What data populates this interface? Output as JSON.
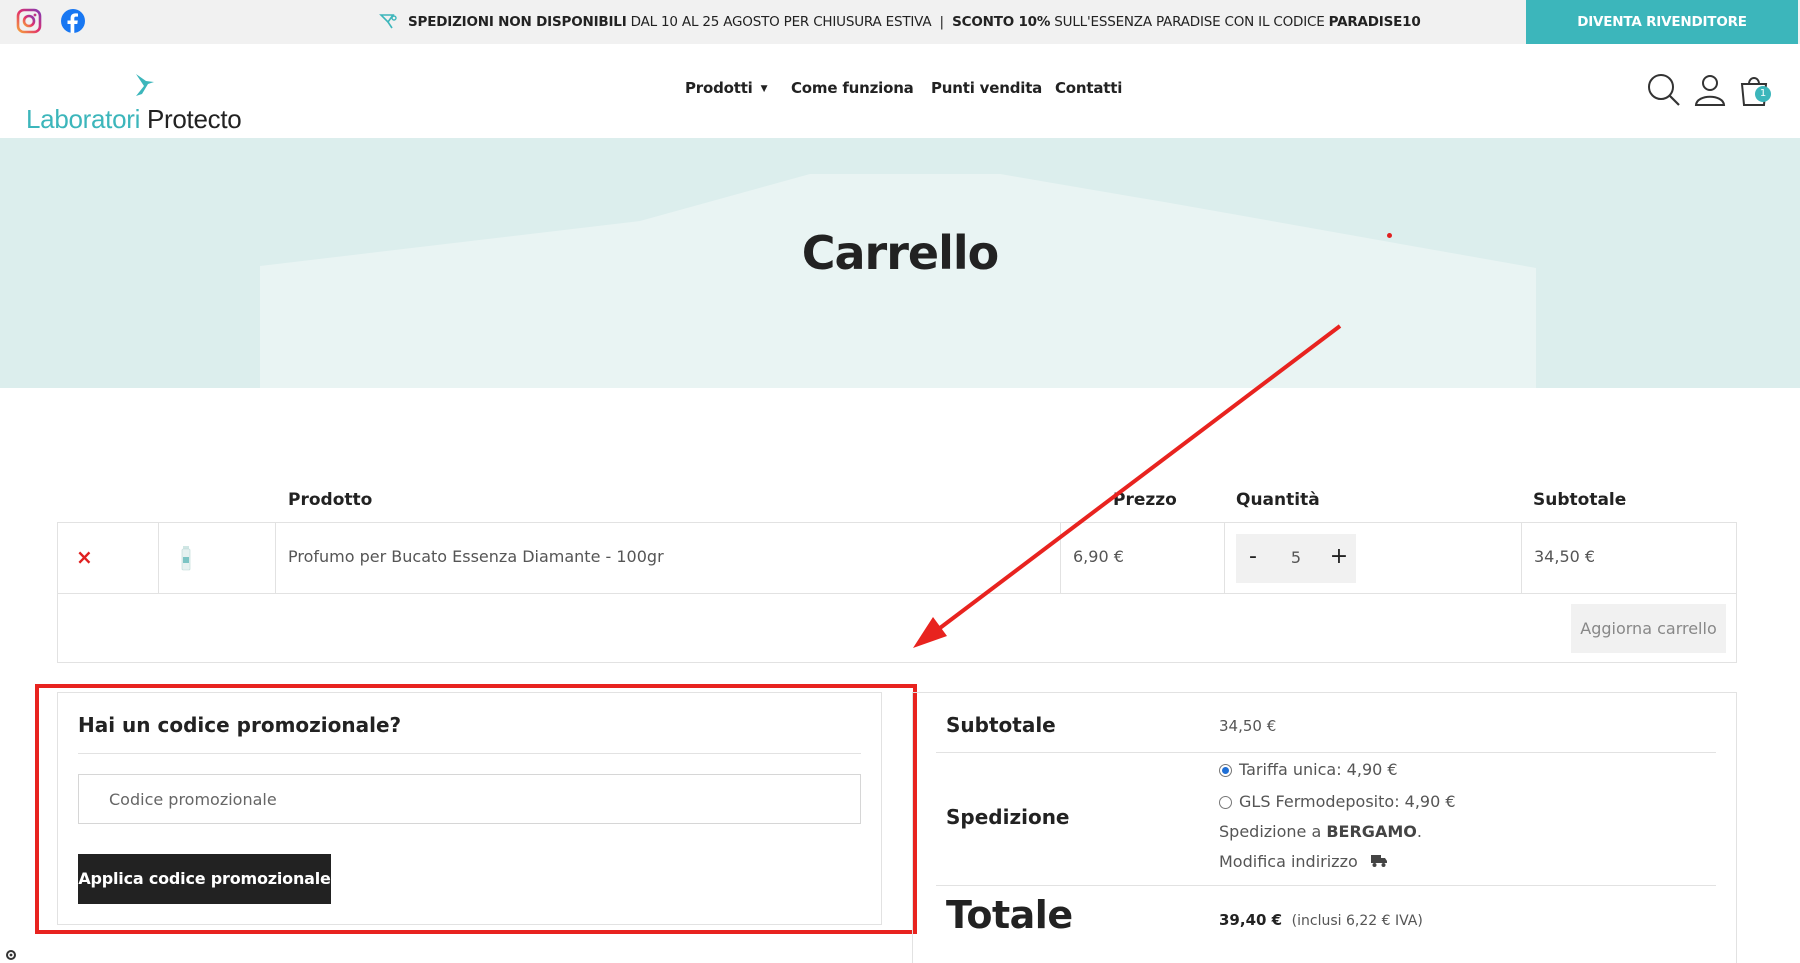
{
  "topbar": {
    "social": [
      "instagram-icon",
      "facebook-icon"
    ],
    "announcement": {
      "part1": "SPEDIZIONI NON DISPONIBILI",
      "part2": " DAL 10 AL 25 AGOSTO PER CHIUSURA ESTIVA  |  ",
      "part3": "SCONTO 10%",
      "part4": " SULL'ESSENZA PARADISE CON IL CODICE ",
      "part5": "PARADISE10"
    },
    "reseller_button": "DIVENTA RIVENDITORE"
  },
  "header": {
    "logo_part1": "Laboratori",
    "logo_part2": " Protecto",
    "nav": [
      "Prodotti",
      "Come funziona",
      "Punti vendita",
      "Contatti"
    ],
    "cart_count": "1"
  },
  "hero": {
    "title": "Carrello"
  },
  "cart": {
    "headers": {
      "product": "Prodotto",
      "price": "Prezzo",
      "quantity": "Quantità",
      "subtotal": "Subtotale"
    },
    "items": [
      {
        "remove": "×",
        "name": "Profumo per Bucato Essenza Diamante - 100gr",
        "price": "6,90 €",
        "quantity": "5",
        "subtotal": "34,50 €"
      }
    ],
    "qty_minus": "-",
    "qty_plus": "+",
    "update_button": "Aggiorna carrello"
  },
  "coupon": {
    "title": "Hai un codice promozionale?",
    "placeholder": "Codice promozionale",
    "button": "Applica codice promozionale"
  },
  "totals": {
    "subtotal_label": "Subtotale",
    "subtotal_value": "34,50 €",
    "shipping_label": "Spedizione",
    "shipping_options": [
      {
        "label": "Tariffa unica: 4,90 €",
        "selected": true
      },
      {
        "label": "GLS Fermodeposito: 4,90 €",
        "selected": false
      }
    ],
    "shipping_to_prefix": "Spedizione a ",
    "shipping_to_city": "BERGAMO",
    "shipping_to_suffix": ".",
    "change_address": "Modifica indirizzo",
    "total_label": "Totale",
    "total_value": "39,40 €",
    "total_tax": "(inclusi 6,22 € IVA)"
  },
  "colors": {
    "accent": "#3cb6bb",
    "hero_bg": "#dceeed",
    "annotation_red": "#e8231f",
    "dark_button": "#222222"
  }
}
